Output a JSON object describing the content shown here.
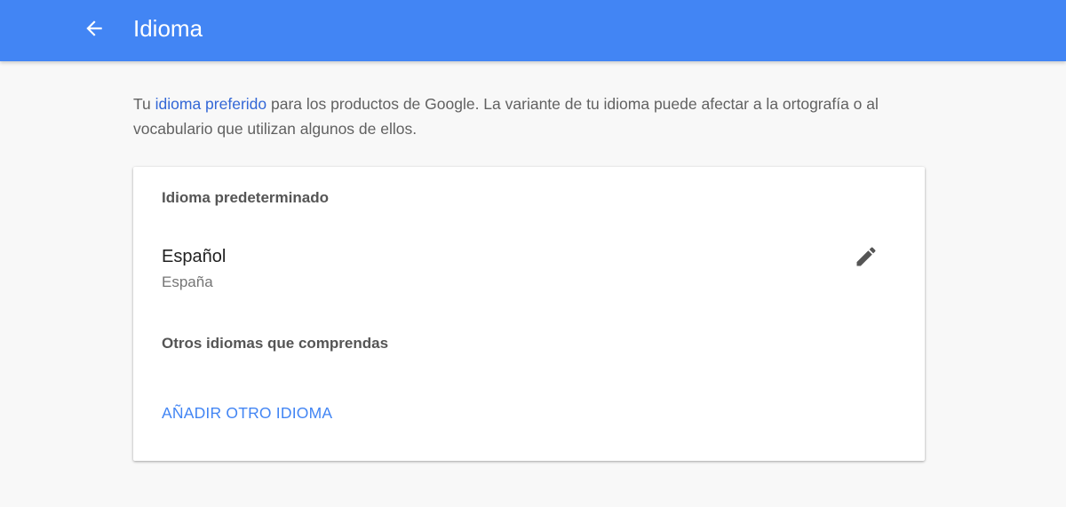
{
  "appbar": {
    "title": "Idioma",
    "back_icon": "arrow-back-icon",
    "color": "#4285f4"
  },
  "intro": {
    "prefix": "Tu ",
    "link": "idioma preferido",
    "suffix": " para los productos de Google. La variante de tu idioma puede afectar a la ortografía o al vocabulario que utilizan algunos de ellos."
  },
  "card": {
    "default_heading": "Idioma predeterminado",
    "default_language": {
      "name": "Español",
      "region": "España",
      "edit_icon": "pencil-icon"
    },
    "other_heading": "Otros idiomas que comprendas",
    "add_label": "AÑADIR OTRO IDIOMA"
  },
  "colors": {
    "accent": "#4285f4",
    "link": "#3367d6"
  }
}
